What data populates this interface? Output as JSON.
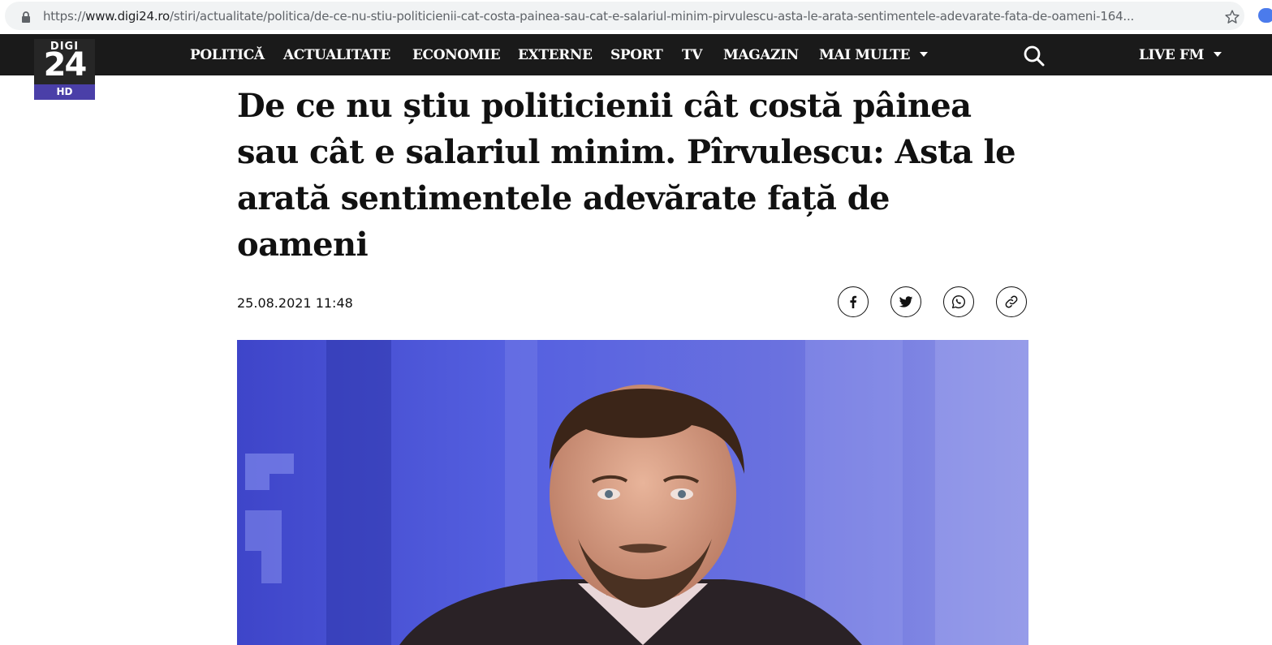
{
  "browser": {
    "url_scheme": "https://",
    "url_host": "www.digi24.ro",
    "url_path": "/stiri/actualitate/politica/de-ce-nu-stiu-politicienii-cat-costa-painea-sau-cat-e-salariul-minim-pirvulescu-asta-le-arata-sentimentele-adevarate-fata-de-oameni-164..."
  },
  "logo": {
    "top": "DIGI",
    "number": "24",
    "badge": "HD"
  },
  "nav": {
    "items": [
      "POLITICĂ",
      "ACTUALITATE",
      "ECONOMIE",
      "EXTERNE",
      "SPORT",
      "TV",
      "MAGAZIN",
      "MAI MULTE"
    ],
    "live": "LIVE FM"
  },
  "article": {
    "title": "De ce nu știu politicienii cât costă pâinea sau cât e salariul minim. Pîrvulescu: Asta le arată sentimentele adevărate față de oameni",
    "date": "25.08.2021 11:48"
  },
  "share": [
    "facebook-icon",
    "twitter-icon",
    "whatsapp-icon",
    "link-icon"
  ],
  "colors": {
    "nav_bg": "#1a1a1a",
    "logo_accent": "#4a3fa8",
    "hero_bg": "#4a52d6"
  }
}
